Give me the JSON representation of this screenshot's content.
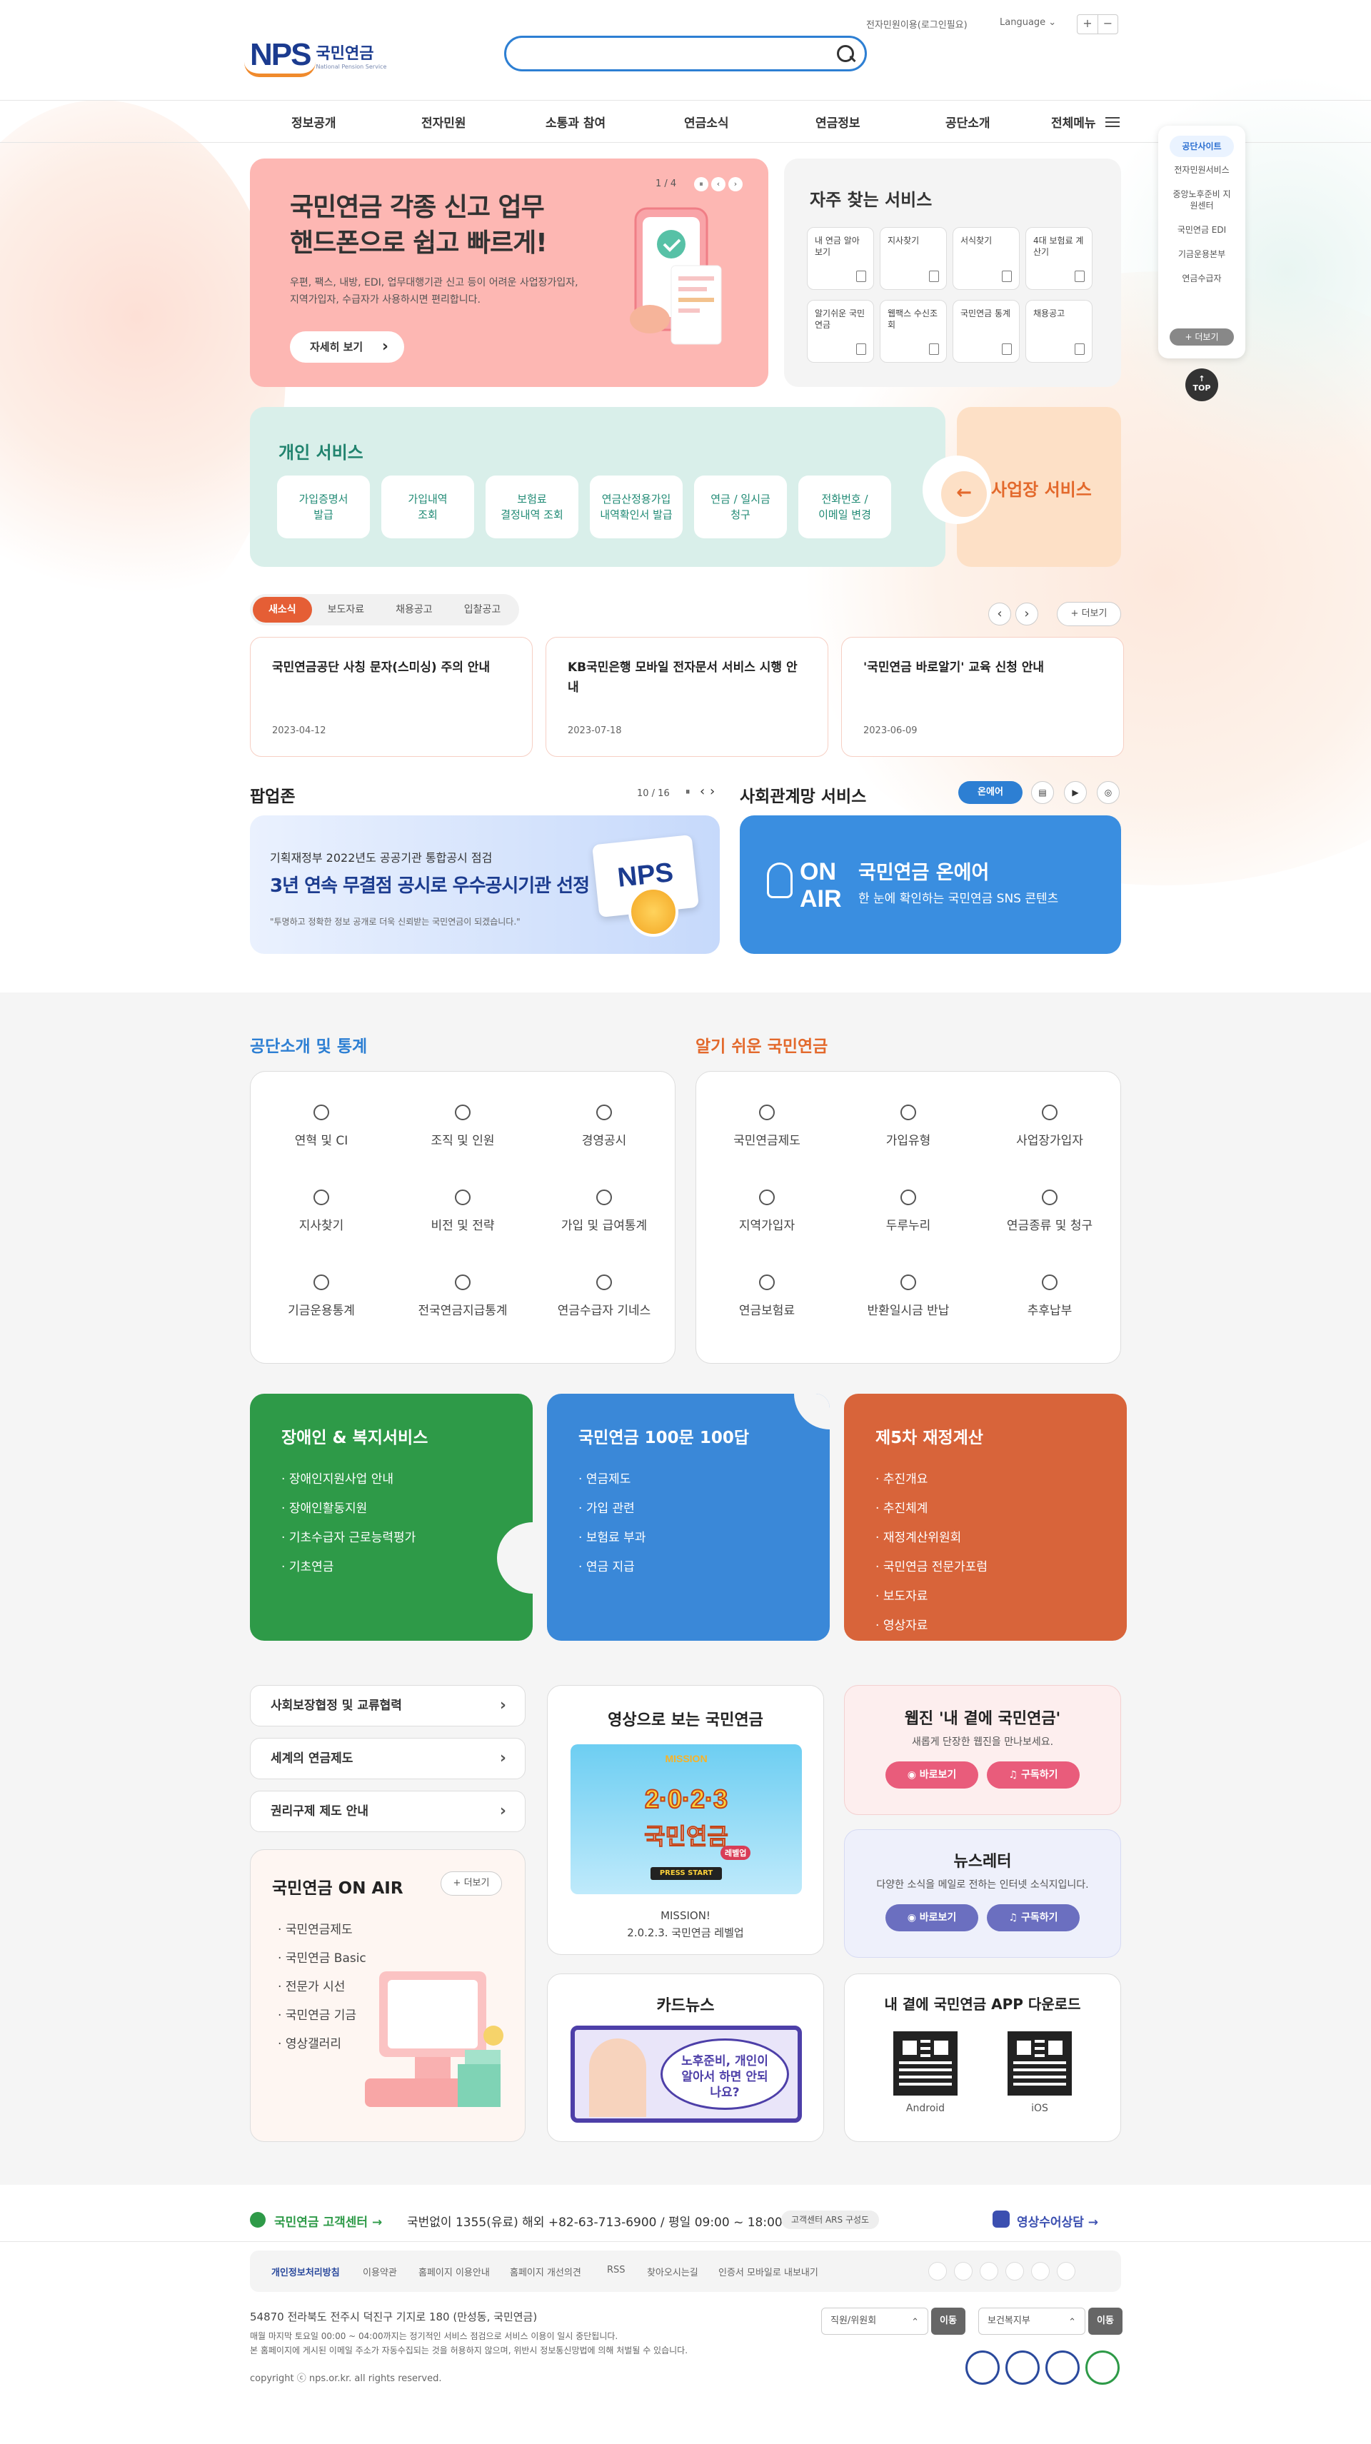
{
  "header": {
    "logo_en": "NPS",
    "logo_ko": "국민연금",
    "logo_sub": "National Pension Service",
    "search_placeholder": "",
    "link_login": "전자민원이용(로그인필요)",
    "language": "Language",
    "zoom_in": "+",
    "zoom_out": "−"
  },
  "gnb": {
    "items": [
      "정보공개",
      "전자민원",
      "소통과 참여",
      "연금소식",
      "연금정보",
      "공단소개"
    ],
    "all_menu": "전체메뉴"
  },
  "side": {
    "title": "공단사이트",
    "items": [
      "전자민원서비스",
      "중앙노후준비 지원센터",
      "국민연금 EDI",
      "기금운용본부",
      "연금수급자"
    ],
    "more": "+ 더보기",
    "top": "TOP"
  },
  "hero": {
    "title_line1": "국민연금 각종 신고 업무",
    "title_line2": "핸드폰으로 쉽고 빠르게!",
    "desc": "우편, 팩스, 내방, EDI, 업무대행기관 신고 등이 어려운 사업장가입자, 지역가입자, 수급자가 사용하시면 편리합니다.",
    "button": "자세히 보기",
    "page": "1 / 4"
  },
  "freq": {
    "title": "자주 찾는 서비스",
    "items": [
      "내 연금 알아보기",
      "지사찾기",
      "서식찾기",
      "4대 보험료 계산기",
      "알기쉬운 국민연금",
      "웹팩스 수신조회",
      "국민연금 통계",
      "채용공고"
    ]
  },
  "personal": {
    "title": "개인 서비스",
    "items": [
      [
        "가입증명서",
        "발급"
      ],
      [
        "가입내역",
        "조회"
      ],
      [
        "보험료",
        "결정내역 조회"
      ],
      [
        "연금산정용가입",
        "내역확인서 발급"
      ],
      [
        "연금 / 일시금",
        "청구"
      ],
      [
        "전화번호 /",
        "이메일 변경"
      ]
    ],
    "biz": "사업장 서비스"
  },
  "news": {
    "tabs": [
      "새소식",
      "보도자료",
      "채용공고",
      "입찰공고"
    ],
    "more": "+ 더보기",
    "items": [
      {
        "title": "국민연금공단 사칭 문자(스미싱) 주의 안내",
        "date": "2023-04-12"
      },
      {
        "title": "KB국민은행 모바일 전자문서 서비스 시행 안내",
        "date": "2023-07-18"
      },
      {
        "title": "'국민연금 바로알기' 교육 신청 안내",
        "date": "2023-06-09"
      }
    ]
  },
  "popup": {
    "title": "팝업존",
    "page": "10 / 16",
    "line1": "기획재정부 2022년도 공공기관 통합공시 점검",
    "line2": "3년 연속 무결점 공시로 우수공시기관 선정",
    "line3": "\"투명하고 정확한 정보 공개로 더욱 신뢰받는 국민연금이 되겠습니다.\"",
    "badge": "NPS"
  },
  "sns": {
    "title": "사회관계망 서비스",
    "onair_btn": "온에어",
    "logo_top": "ON",
    "logo_bottom": "AIR",
    "card_title": "국민연금 온에어",
    "card_sub": "한 눈에 확인하는 국민연금 SNS 콘텐츠"
  },
  "intro": {
    "title": "공단소개 및 통계",
    "color": "#2d7fd3",
    "items": [
      "연혁 및 CI",
      "조직 및 인원",
      "경영공시",
      "지사찾기",
      "비전 및 전략",
      "가입 및 급여통계",
      "기금운용통계",
      "전국연금지급통계",
      "연금수급자 기네스"
    ]
  },
  "easy": {
    "title": "알기 쉬운 국민연금",
    "color": "#e3692c",
    "items": [
      "국민연금제도",
      "가입유형",
      "사업장가입자",
      "지역가입자",
      "두루누리",
      "연금종류 및 청구",
      "연금보험료",
      "반환일시금 반납",
      "추후납부"
    ]
  },
  "cards": [
    {
      "title": "장애인 & 복지서비스",
      "color": "#2e9a48",
      "items": [
        "장애인지원사업 안내",
        "장애인활동지원",
        "기초수급자 근로능력평가",
        "기초연금"
      ]
    },
    {
      "title": "국민연금 100문 100답",
      "color": "#3a88d8",
      "items": [
        "연금제도",
        "가입 관련",
        "보험료 부과",
        "연금 지급"
      ]
    },
    {
      "title": "제5차 재정계산",
      "color": "#d8643a",
      "items": [
        "추진개요",
        "추진체계",
        "재정계산위원회",
        "국민연금 전문가포럼",
        "보도자료",
        "영상자료"
      ]
    }
  ],
  "links": [
    "사회보장협정 및 교류협력",
    "세계의 연금제도",
    "권리구제 제도 안내"
  ],
  "onair_box": {
    "title": "국민연금 ON AIR",
    "more": "+ 더보기",
    "items": [
      "국민연금제도",
      "국민연금 Basic",
      "전문가 시선",
      "국민연금 기금",
      "영상갤러리"
    ]
  },
  "video": {
    "title": "영상으로 보는 국민연금",
    "caption1": "MISSION!",
    "caption2": "2.0.2.3. 국민연금 레벨업",
    "banner_top": "MISSION",
    "banner_year": "2·0·2·3",
    "banner_main": "국민연금",
    "banner_sub": "레벨업",
    "banner_btn": "PRESS START"
  },
  "cardnews": {
    "title": "카드뉴스",
    "bubble": "노후준비, 개인이 알아서 하면 안되나요?"
  },
  "webzine": {
    "title": "웹진 '내 곁에 국민연금'",
    "sub": "새롭게 단장한 웹진을 만나보세요.",
    "btn1": "바로보기",
    "btn2": "구독하기"
  },
  "newsletter": {
    "title": "뉴스레터",
    "sub": "다양한 소식을 메일로 전하는 인터넷 소식지입니다.",
    "btn1": "바로보기",
    "btn2": "구독하기"
  },
  "app": {
    "title": "내 곁에 국민연금 APP 다운로드",
    "android": "Android",
    "ios": "iOS"
  },
  "footer": {
    "center": "국민연금 고객센터",
    "phone": "국번없이 1355(유료) 해외 +82-63-713-6900 / 평일 09:00 ~ 18:00",
    "ars": "고객센터 ARS 구성도",
    "sign": "영상수어상담",
    "links": [
      "개인정보처리방침",
      "이용약관",
      "홈페이지 이용안내",
      "홈페이지 개선의견",
      "RSS",
      "찾아오시는길",
      "인증서 모바일로 내보내기"
    ],
    "address": "54870 전라북도 전주시 덕진구 기지로 180 (만성동, 국민연금)",
    "info1": "매월 마지막 토요일 00:00 ~ 04:00까지는 정기적인 서비스 점검으로 서비스 이용이 일시 중단됩니다.",
    "info2": "본 홈페이지에 게시된 이메일 주소가 자동수집되는 것을 허용하지 않으며, 위반시 정보통신망법에 의해 처벌될 수 있습니다.",
    "copyright": "copyright ⓒ nps.or.kr. all rights reserved.",
    "select1": "직원/위원회",
    "select2": "보건복지부",
    "go": "이동"
  }
}
